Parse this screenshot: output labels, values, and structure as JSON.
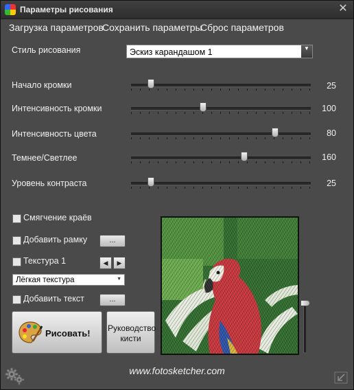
{
  "window": {
    "title": "Параметры рисования"
  },
  "menu": [
    "Загрузка параметров",
    "Сохранить параметры",
    "Сброс параметров"
  ],
  "style": {
    "label": "Стиль рисования",
    "value": "Эскиз карандашом 1"
  },
  "sliders": [
    {
      "label": "Начало кромки",
      "value": "25",
      "position": 0.11
    },
    {
      "label": "Интенсивность кромки",
      "value": "100",
      "position": 0.4
    },
    {
      "label": "Интенсивность цвета",
      "value": "80",
      "position": 0.8
    },
    {
      "label": "Темнее/Светлее",
      "value": "160",
      "position": 0.63
    },
    {
      "label": "Уровень контраста",
      "value": "25",
      "position": 0.11
    }
  ],
  "options": {
    "smooth_edges": "Смягчение краёв",
    "add_frame": "Добавить рамку",
    "texture": "Текстура 1",
    "texture_select": "Лёгкая текстура",
    "add_text": "Добавить текст",
    "ellipsis": "...",
    "nav_prev": "◀",
    "nav_next": "▶"
  },
  "buttons": {
    "draw": "Рисовать!",
    "brush_guide": "Руководство кисти"
  },
  "footer": {
    "website": "www.fotosketcher.com"
  },
  "preview_zoom": 0.0
}
